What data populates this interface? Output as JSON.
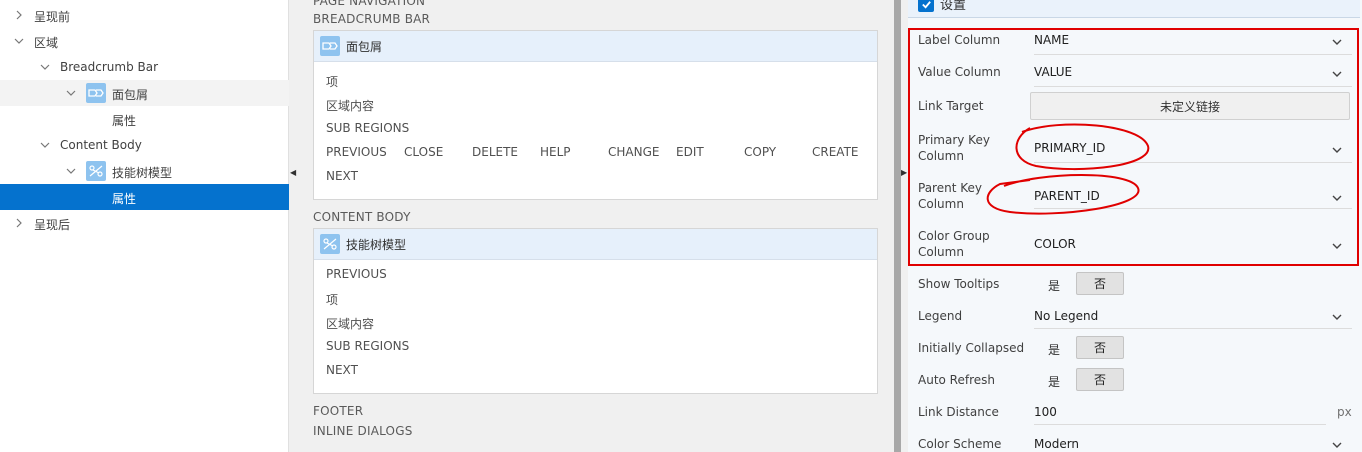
{
  "tree": {
    "items": [
      {
        "label": "呈现前"
      },
      {
        "label": "区域"
      },
      {
        "label": "Breadcrumb Bar"
      },
      {
        "label": "面包屑"
      },
      {
        "label": "属性"
      },
      {
        "label": "Content Body"
      },
      {
        "label": "技能树模型"
      },
      {
        "label": "属性"
      },
      {
        "label": "呈现后"
      }
    ]
  },
  "layout": {
    "sections": {
      "page_navigation": "PAGE NAVIGATION",
      "breadcrumb_bar": "BREADCRUMB BAR",
      "content_body": "CONTENT BODY",
      "footer": "FOOTER",
      "inline_dialogs": "INLINE DIALOGS"
    },
    "breadcrumb_region": {
      "title": "面包屑",
      "lines": [
        "项",
        "区域内容",
        "SUB REGIONS"
      ],
      "buttons": [
        "PREVIOUS",
        "CLOSE",
        "DELETE",
        "HELP",
        "CHANGE",
        "EDIT",
        "COPY",
        "CREATE"
      ],
      "next": "NEXT"
    },
    "content_region": {
      "title": "技能树模型",
      "lines": [
        "PREVIOUS",
        "项",
        "区域内容",
        "SUB REGIONS",
        "NEXT"
      ]
    }
  },
  "props": {
    "group_title": "设置",
    "label_column": {
      "label": "Label Column",
      "value": "NAME"
    },
    "value_column": {
      "label": "Value Column",
      "value": "VALUE"
    },
    "link_target": {
      "label": "Link Target",
      "button": "未定义链接"
    },
    "primary_key": {
      "label": "Primary Key Column",
      "value": "PRIMARY_ID"
    },
    "parent_key": {
      "label": "Parent Key Column",
      "value": "PARENT_ID"
    },
    "color_group": {
      "label": "Color Group Column",
      "value": "COLOR"
    },
    "show_tooltips": {
      "label": "Show Tooltips",
      "yes": "是",
      "no": "否"
    },
    "legend": {
      "label": "Legend",
      "value": "No Legend"
    },
    "initially_collapsed": {
      "label": "Initially Collapsed",
      "yes": "是",
      "no": "否"
    },
    "auto_refresh": {
      "label": "Auto Refresh",
      "yes": "是",
      "no": "否"
    },
    "link_distance": {
      "label": "Link Distance",
      "value": "100",
      "unit": "px"
    },
    "color_scheme": {
      "label": "Color Scheme",
      "value": "Modern"
    }
  },
  "colors": {
    "selection": "#0572ce",
    "annotation_red": "#e00000",
    "region_header": "#e6f0fb"
  }
}
